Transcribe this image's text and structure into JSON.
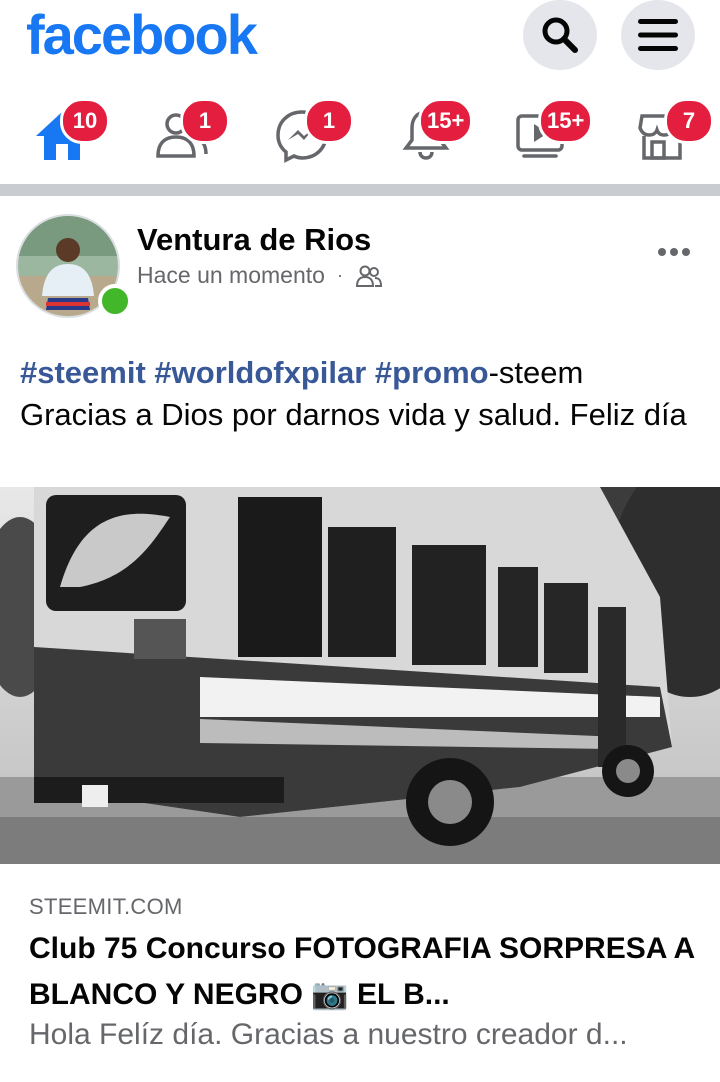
{
  "header": {
    "logo": "facebook",
    "search_icon": "search-icon",
    "menu_icon": "hamburger-menu-icon"
  },
  "nav": [
    {
      "icon": "home-icon",
      "badge": "10",
      "active": true
    },
    {
      "icon": "friends-icon",
      "badge": "1"
    },
    {
      "icon": "messenger-icon",
      "badge": "1"
    },
    {
      "icon": "bell-icon",
      "badge": "15+"
    },
    {
      "icon": "watch-icon",
      "badge": "15+"
    },
    {
      "icon": "marketplace-icon",
      "badge": "7"
    }
  ],
  "post": {
    "author": "Ventura de Rios",
    "time": "Hace un momento",
    "dot": "·",
    "audience_icon": "friends-audience-icon",
    "tags": [
      "#steemit",
      "#worldofxpilar",
      "#promo"
    ],
    "text_after_tags": "-steem",
    "body": "Gracias a Dios por darnos vida y salud. Feliz día",
    "photo_icon": "bus-photo"
  },
  "link": {
    "domain": "STEEMIT.COM",
    "title": "Club 75 Concurso FOTOGRAFIA SORPRESA A BLANCO Y NEGRO 📷 EL B...",
    "description": "Hola Felíz día. Gracias a nuestro creador d..."
  },
  "colors": {
    "brand": "#1877f2",
    "badge": "#e41e3f",
    "hashtag": "#385898",
    "online": "#42b72a"
  }
}
